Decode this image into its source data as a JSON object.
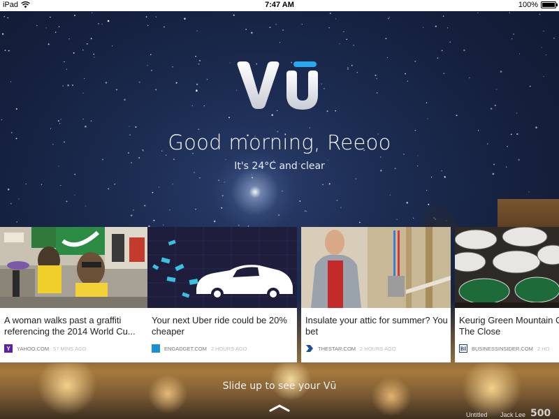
{
  "statusbar": {
    "device": "iPad",
    "time": "7:47 AM",
    "battery": "100%",
    "battery_level": 1.0
  },
  "app": {
    "logo_text": "Vū",
    "greeting": "Good morning, Reeoo",
    "weather": "It's 24°C and clear"
  },
  "cards": [
    {
      "title": "A woman walks past a graffiti referencing the 2014 World Cu...",
      "source": "YAHOO.COM",
      "time": "57 MINS AGO",
      "source_icon": "yahoo-icon",
      "icon_letter": "Y",
      "icon_color": "#5c1fa6"
    },
    {
      "title": "Your next Uber ride could be 20% cheaper",
      "source": "ENGADGET.COM",
      "time": "2 HOURS AGO",
      "source_icon": "engadget-icon",
      "icon_letter": "",
      "icon_color": "#1a8fd6"
    },
    {
      "title": "Insulate your attic for summer? You bet",
      "source": "THESTAR.COM",
      "time": "2 HOURS AGO",
      "source_icon": "thestar-icon",
      "icon_letter": "",
      "icon_color": "#1e4f9b"
    },
    {
      "title": "Keurig Green Mountain Crazy Into The Close",
      "source": "BUSINESSINSIDER.COM",
      "time": "2 HO",
      "source_icon": "businessinsider-icon",
      "icon_letter": "BI",
      "icon_color": "#ffffff"
    }
  ],
  "footer": {
    "slide_up": "Slide up to see your Vū",
    "photo_title": "Untitled",
    "photographer": "Jack Lee",
    "photo_service": "500"
  },
  "colors": {
    "accent": "#2aa8ef",
    "sky": "#1c2c52"
  }
}
